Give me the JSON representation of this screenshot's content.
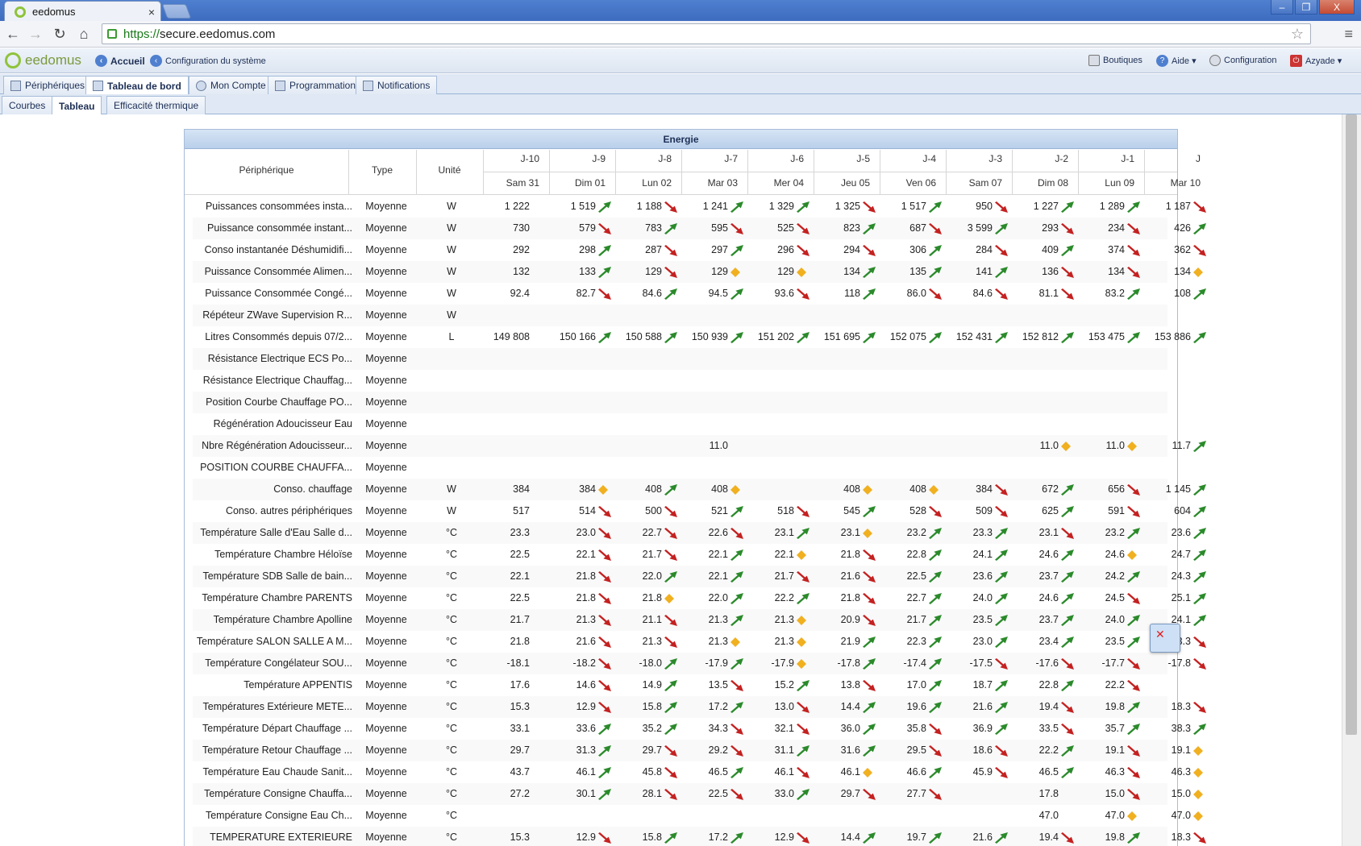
{
  "browser": {
    "tab_title": "eedomus",
    "tab_close": "×",
    "url_scheme": "https://",
    "url_host": "secure.eedomus.com",
    "win_min": "–",
    "win_max": "❐",
    "win_close": "X"
  },
  "appbar": {
    "logo": "eedomus",
    "accueil": "Accueil",
    "config_sys": "Configuration du système",
    "boutiques": "Boutiques",
    "aide": "Aide ▾",
    "configuration": "Configuration",
    "user": "Azyade ▾"
  },
  "tabs1": [
    "Périphériques",
    "Tableau de bord",
    "Mon Compte",
    "Programmation",
    "Notifications"
  ],
  "tabs2": [
    "Courbes",
    "Tableau",
    "Efficacité thermique"
  ],
  "panel": {
    "title": "Energie",
    "col_peripheral": "Périphérique",
    "col_type": "Type",
    "col_unit": "Unité",
    "days": [
      {
        "rel": "J-10",
        "date": "Sam 31"
      },
      {
        "rel": "J-9",
        "date": "Dim 01"
      },
      {
        "rel": "J-8",
        "date": "Lun 02"
      },
      {
        "rel": "J-7",
        "date": "Mar 03"
      },
      {
        "rel": "J-6",
        "date": "Mer 04"
      },
      {
        "rel": "J-5",
        "date": "Jeu 05"
      },
      {
        "rel": "J-4",
        "date": "Ven 06"
      },
      {
        "rel": "J-3",
        "date": "Sam 07"
      },
      {
        "rel": "J-2",
        "date": "Dim 08"
      },
      {
        "rel": "J-1",
        "date": "Lun 09"
      },
      {
        "rel": "J",
        "date": "Mar 10"
      }
    ]
  },
  "rows": [
    {
      "name": "Puissances consommées insta...",
      "type": "Moyenne",
      "unit": "W",
      "values": [
        "1 222",
        "1 519",
        "1 188",
        "1 241",
        "1 329",
        "1 325",
        "1 517",
        "950",
        "1 227",
        "1 289",
        "1 187"
      ],
      "trends": [
        "",
        "up",
        "down",
        "up",
        "up",
        "down",
        "up",
        "down",
        "up",
        "up",
        "down"
      ]
    },
    {
      "name": "Puissance consommée instant...",
      "type": "Moyenne",
      "unit": "W",
      "values": [
        "730",
        "579",
        "783",
        "595",
        "525",
        "823",
        "687",
        "3 599",
        "293",
        "234",
        "426"
      ],
      "trends": [
        "",
        "down",
        "up",
        "down",
        "down",
        "up",
        "down",
        "up",
        "down",
        "down",
        "up"
      ]
    },
    {
      "name": "Conso instantanée Déshumidifi...",
      "type": "Moyenne",
      "unit": "W",
      "values": [
        "292",
        "298",
        "287",
        "297",
        "296",
        "294",
        "306",
        "284",
        "409",
        "374",
        "362"
      ],
      "trends": [
        "",
        "up",
        "down",
        "up",
        "down",
        "down",
        "up",
        "down",
        "up",
        "down",
        "down"
      ]
    },
    {
      "name": "Puissance Consommée Alimen...",
      "type": "Moyenne",
      "unit": "W",
      "values": [
        "132",
        "133",
        "129",
        "129",
        "129",
        "134",
        "135",
        "141",
        "136",
        "134",
        "134"
      ],
      "trends": [
        "",
        "up",
        "down",
        "eq",
        "eq",
        "up",
        "up",
        "up",
        "down",
        "down",
        "eq"
      ]
    },
    {
      "name": "Puissance Consommée Congé...",
      "type": "Moyenne",
      "unit": "W",
      "values": [
        "92.4",
        "82.7",
        "84.6",
        "94.5",
        "93.6",
        "118",
        "86.0",
        "84.6",
        "81.1",
        "83.2",
        "108"
      ],
      "trends": [
        "",
        "down",
        "up",
        "up",
        "down",
        "up",
        "down",
        "down",
        "down",
        "up",
        "up"
      ]
    },
    {
      "name": "Répéteur ZWave Supervision R...",
      "type": "Moyenne",
      "unit": "W",
      "values": [
        "",
        "",
        "",
        "",
        "",
        "",
        "",
        "",
        "",
        "",
        ""
      ],
      "trends": [
        "",
        "",
        "",
        "",
        "",
        "",
        "",
        "",
        "",
        "",
        ""
      ]
    },
    {
      "name": "Litres Consommés depuis 07/2...",
      "type": "Moyenne",
      "unit": "L",
      "values": [
        "149 808",
        "150 166",
        "150 588",
        "150 939",
        "151 202",
        "151 695",
        "152 075",
        "152 431",
        "152 812",
        "153 475",
        "153 886"
      ],
      "trends": [
        "",
        "up",
        "up",
        "up",
        "up",
        "up",
        "up",
        "up",
        "up",
        "up",
        "up"
      ]
    },
    {
      "name": "Résistance Electrique ECS Po...",
      "type": "Moyenne",
      "unit": "",
      "values": [
        "",
        "",
        "",
        "",
        "",
        "",
        "",
        "",
        "",
        "",
        ""
      ],
      "trends": [
        "",
        "",
        "",
        "",
        "",
        "",
        "",
        "",
        "",
        "",
        ""
      ]
    },
    {
      "name": "Résistance Electrique Chauffag...",
      "type": "Moyenne",
      "unit": "",
      "values": [
        "",
        "",
        "",
        "",
        "",
        "",
        "",
        "",
        "",
        "",
        ""
      ],
      "trends": [
        "",
        "",
        "",
        "",
        "",
        "",
        "",
        "",
        "",
        "",
        ""
      ]
    },
    {
      "name": "Position Courbe Chauffage PO...",
      "type": "Moyenne",
      "unit": "",
      "values": [
        "",
        "",
        "",
        "",
        "",
        "",
        "",
        "",
        "",
        "",
        ""
      ],
      "trends": [
        "",
        "",
        "",
        "",
        "",
        "",
        "",
        "",
        "",
        "",
        ""
      ]
    },
    {
      "name": "Régénération Adoucisseur Eau",
      "type": "Moyenne",
      "unit": "",
      "values": [
        "",
        "",
        "",
        "",
        "",
        "",
        "",
        "",
        "",
        "",
        ""
      ],
      "trends": [
        "",
        "",
        "",
        "",
        "",
        "",
        "",
        "",
        "",
        "",
        ""
      ]
    },
    {
      "name": "Nbre Régénération Adoucisseur...",
      "type": "Moyenne",
      "unit": "",
      "values": [
        "",
        "",
        "",
        "11.0",
        "",
        "",
        "",
        "",
        "11.0",
        "11.0",
        "11.7"
      ],
      "trends": [
        "",
        "",
        "",
        "",
        "",
        "",
        "",
        "",
        "eq",
        "eq",
        "up"
      ]
    },
    {
      "name": "POSITION COURBE CHAUFFA...",
      "type": "Moyenne",
      "unit": "",
      "values": [
        "",
        "",
        "",
        "",
        "",
        "",
        "",
        "",
        "",
        "",
        ""
      ],
      "trends": [
        "",
        "",
        "",
        "",
        "",
        "",
        "",
        "",
        "",
        "",
        ""
      ]
    },
    {
      "name": "Conso. chauffage",
      "type": "Moyenne",
      "unit": "W",
      "values": [
        "384",
        "384",
        "408",
        "408",
        "",
        "408",
        "408",
        "384",
        "672",
        "656",
        "1 145"
      ],
      "trends": [
        "",
        "eq",
        "up",
        "eq",
        "",
        "eq",
        "eq",
        "down",
        "up",
        "down",
        "up"
      ]
    },
    {
      "name": "Conso. autres périphériques",
      "type": "Moyenne",
      "unit": "W",
      "values": [
        "517",
        "514",
        "500",
        "521",
        "518",
        "545",
        "528",
        "509",
        "625",
        "591",
        "604"
      ],
      "trends": [
        "",
        "down",
        "down",
        "up",
        "down",
        "up",
        "down",
        "down",
        "up",
        "down",
        "up"
      ]
    },
    {
      "name": "Température Salle d'Eau Salle d...",
      "type": "Moyenne",
      "unit": "°C",
      "values": [
        "23.3",
        "23.0",
        "22.7",
        "22.6",
        "23.1",
        "23.1",
        "23.2",
        "23.3",
        "23.1",
        "23.2",
        "23.6"
      ],
      "trends": [
        "",
        "down",
        "down",
        "down",
        "up",
        "eq",
        "up",
        "up",
        "down",
        "up",
        "up"
      ]
    },
    {
      "name": "Température Chambre Héloïse",
      "type": "Moyenne",
      "unit": "°C",
      "values": [
        "22.5",
        "22.1",
        "21.7",
        "22.1",
        "22.1",
        "21.8",
        "22.8",
        "24.1",
        "24.6",
        "24.6",
        "24.7"
      ],
      "trends": [
        "",
        "down",
        "down",
        "up",
        "eq",
        "down",
        "up",
        "up",
        "up",
        "eq",
        "up"
      ]
    },
    {
      "name": "Température SDB Salle de bain...",
      "type": "Moyenne",
      "unit": "°C",
      "values": [
        "22.1",
        "21.8",
        "22.0",
        "22.1",
        "21.7",
        "21.6",
        "22.5",
        "23.6",
        "23.7",
        "24.2",
        "24.3"
      ],
      "trends": [
        "",
        "down",
        "up",
        "up",
        "down",
        "down",
        "up",
        "up",
        "up",
        "up",
        "up"
      ]
    },
    {
      "name": "Température Chambre PARENTS",
      "type": "Moyenne",
      "unit": "°C",
      "values": [
        "22.5",
        "21.8",
        "21.8",
        "22.0",
        "22.2",
        "21.8",
        "22.7",
        "24.0",
        "24.6",
        "24.5",
        "25.1"
      ],
      "trends": [
        "",
        "down",
        "eq",
        "up",
        "up",
        "down",
        "up",
        "up",
        "up",
        "down",
        "up"
      ]
    },
    {
      "name": "Température Chambre Apolline",
      "type": "Moyenne",
      "unit": "°C",
      "values": [
        "21.7",
        "21.3",
        "21.1",
        "21.3",
        "21.3",
        "20.9",
        "21.7",
        "23.5",
        "23.7",
        "24.0",
        "24.1"
      ],
      "trends": [
        "",
        "down",
        "down",
        "up",
        "eq",
        "down",
        "up",
        "up",
        "up",
        "up",
        "up"
      ]
    },
    {
      "name": "Température SALON SALLE A M...",
      "type": "Moyenne",
      "unit": "°C",
      "values": [
        "21.8",
        "21.6",
        "21.3",
        "21.3",
        "21.3",
        "21.9",
        "22.3",
        "23.0",
        "23.4",
        "23.5",
        "23.3"
      ],
      "trends": [
        "",
        "down",
        "down",
        "eq",
        "eq",
        "up",
        "up",
        "up",
        "up",
        "up",
        "down"
      ]
    },
    {
      "name": "Température Congélateur SOU...",
      "type": "Moyenne",
      "unit": "°C",
      "values": [
        "-18.1",
        "-18.2",
        "-18.0",
        "-17.9",
        "-17.9",
        "-17.8",
        "-17.4",
        "-17.5",
        "-17.6",
        "-17.7",
        "-17.8"
      ],
      "trends": [
        "",
        "down",
        "up",
        "up",
        "eq",
        "up",
        "up",
        "down",
        "down",
        "down",
        "down"
      ]
    },
    {
      "name": "Température APPENTIS",
      "type": "Moyenne",
      "unit": "°C",
      "values": [
        "17.6",
        "14.6",
        "14.9",
        "13.5",
        "15.2",
        "13.8",
        "17.0",
        "18.7",
        "22.8",
        "22.2",
        ""
      ],
      "trends": [
        "",
        "down",
        "up",
        "down",
        "up",
        "down",
        "up",
        "up",
        "up",
        "down",
        ""
      ]
    },
    {
      "name": "Températures Extérieure METE...",
      "type": "Moyenne",
      "unit": "°C",
      "values": [
        "15.3",
        "12.9",
        "15.8",
        "17.2",
        "13.0",
        "14.4",
        "19.6",
        "21.6",
        "19.4",
        "19.8",
        "18.3"
      ],
      "trends": [
        "",
        "down",
        "up",
        "up",
        "down",
        "up",
        "up",
        "up",
        "down",
        "up",
        "down"
      ]
    },
    {
      "name": "Température Départ Chauffage ...",
      "type": "Moyenne",
      "unit": "°C",
      "values": [
        "33.1",
        "33.6",
        "35.2",
        "34.3",
        "32.1",
        "36.0",
        "35.8",
        "36.9",
        "33.5",
        "35.7",
        "38.3"
      ],
      "trends": [
        "",
        "up",
        "up",
        "down",
        "down",
        "up",
        "down",
        "up",
        "down",
        "up",
        "up"
      ]
    },
    {
      "name": "Température Retour Chauffage ...",
      "type": "Moyenne",
      "unit": "°C",
      "values": [
        "29.7",
        "31.3",
        "29.7",
        "29.2",
        "31.1",
        "31.6",
        "29.5",
        "18.6",
        "22.2",
        "19.1",
        "19.1"
      ],
      "trends": [
        "",
        "up",
        "down",
        "down",
        "up",
        "up",
        "down",
        "down",
        "up",
        "down",
        "eq"
      ]
    },
    {
      "name": "Température Eau Chaude Sanit...",
      "type": "Moyenne",
      "unit": "°C",
      "values": [
        "43.7",
        "46.1",
        "45.8",
        "46.5",
        "46.1",
        "46.1",
        "46.6",
        "45.9",
        "46.5",
        "46.3",
        "46.3"
      ],
      "trends": [
        "",
        "up",
        "down",
        "up",
        "down",
        "eq",
        "up",
        "down",
        "up",
        "down",
        "eq"
      ]
    },
    {
      "name": "Température Consigne Chauffa...",
      "type": "Moyenne",
      "unit": "°C",
      "values": [
        "27.2",
        "30.1",
        "28.1",
        "22.5",
        "33.0",
        "29.7",
        "27.7",
        "",
        "17.8",
        "15.0",
        "15.0"
      ],
      "trends": [
        "",
        "up",
        "down",
        "down",
        "up",
        "down",
        "down",
        "",
        "",
        "down",
        "eq"
      ]
    },
    {
      "name": "Température Consigne Eau Ch...",
      "type": "Moyenne",
      "unit": "°C",
      "values": [
        "",
        "",
        "",
        "",
        "",
        "",
        "",
        "",
        "47.0",
        "47.0",
        "47.0"
      ],
      "trends": [
        "",
        "",
        "",
        "",
        "",
        "",
        "",
        "",
        "",
        "eq",
        "eq"
      ]
    },
    {
      "name": "TEMPERATURE EXTERIEURE",
      "type": "Moyenne",
      "unit": "°C",
      "values": [
        "15.3",
        "12.9",
        "15.8",
        "17.2",
        "12.9",
        "14.4",
        "19.7",
        "21.6",
        "19.4",
        "19.8",
        "18.3"
      ],
      "trends": [
        "",
        "down",
        "up",
        "up",
        "down",
        "up",
        "up",
        "up",
        "down",
        "up",
        "down"
      ]
    }
  ]
}
